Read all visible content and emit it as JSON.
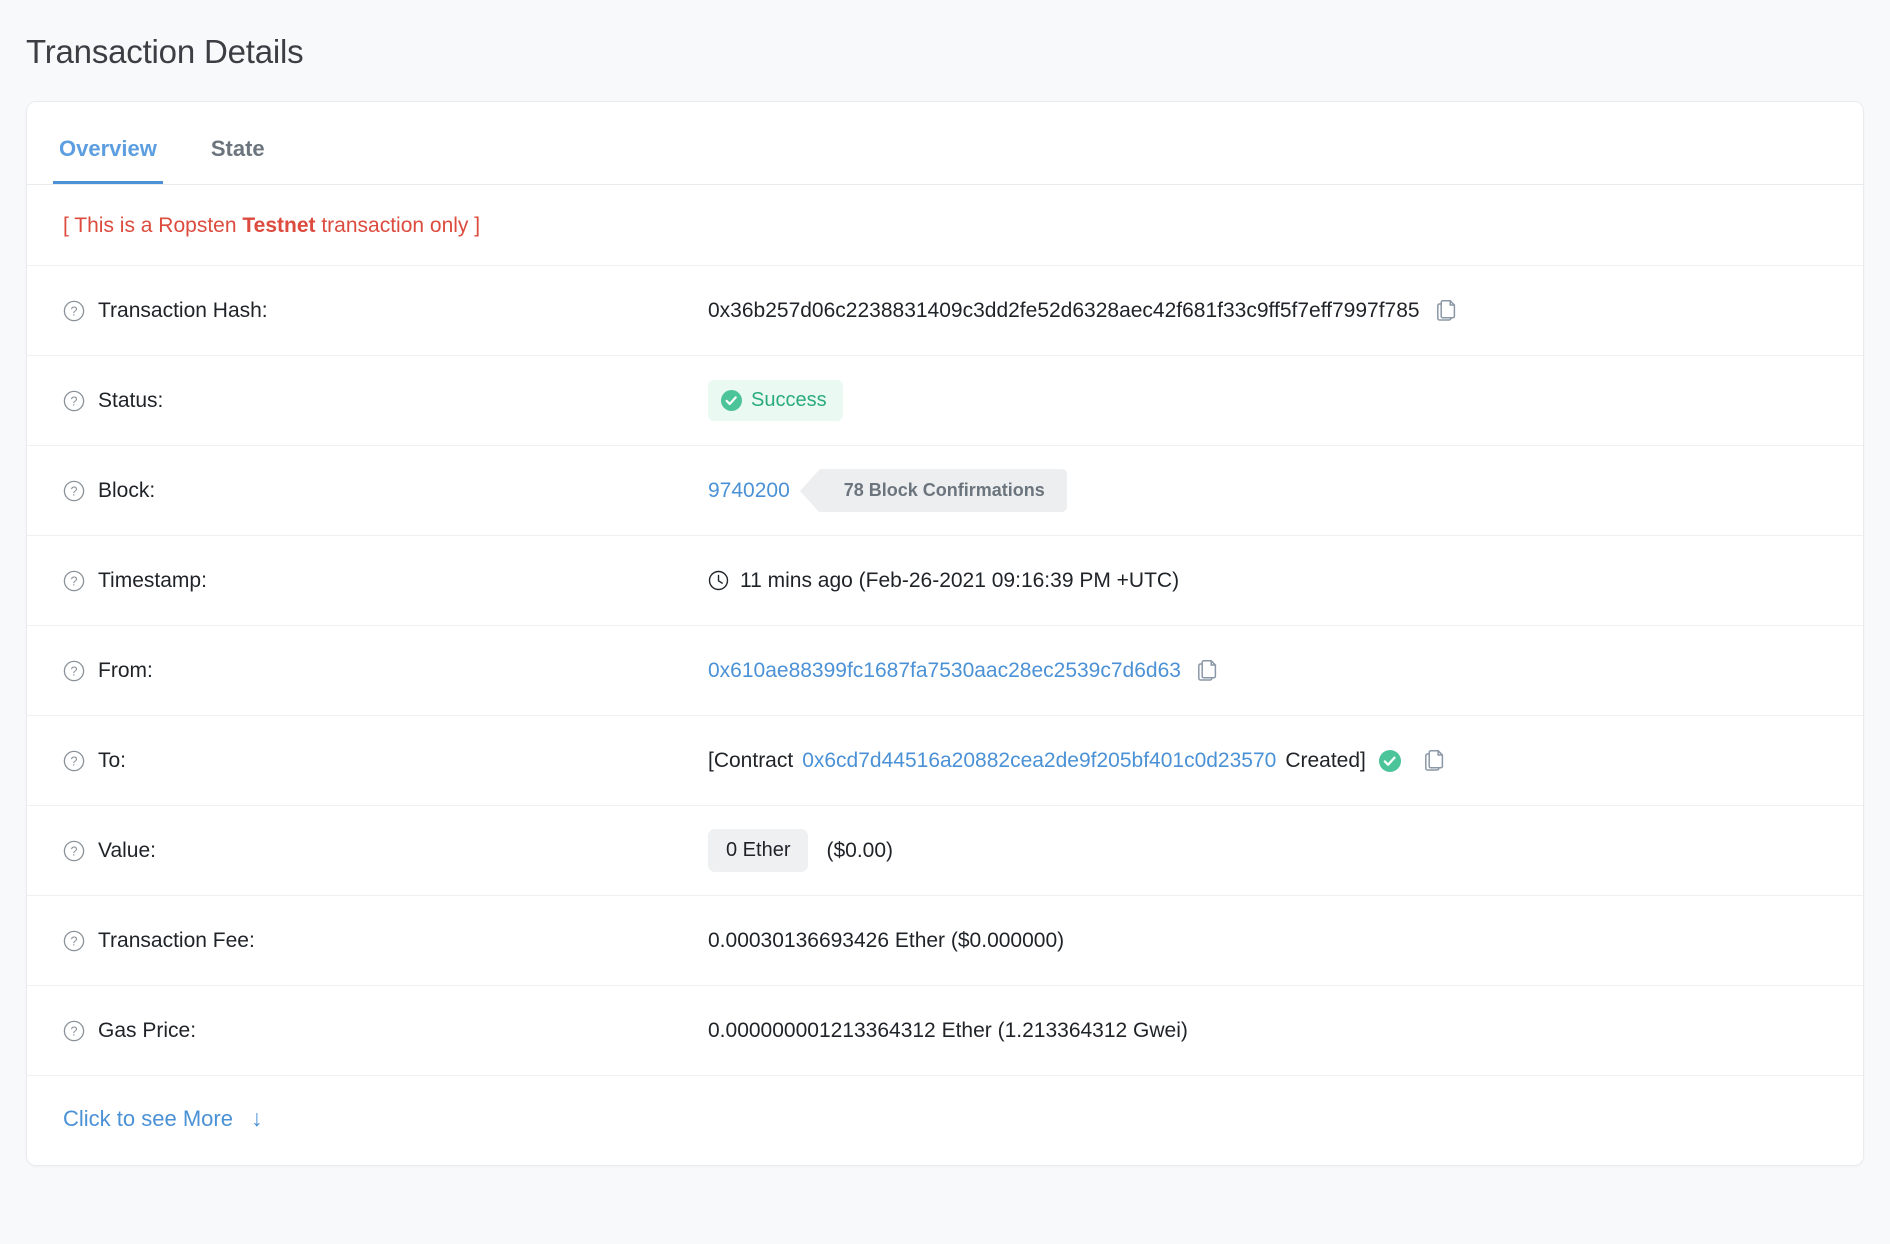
{
  "header": {
    "title": "Transaction Details"
  },
  "tabs": [
    {
      "label": "Overview",
      "active": true
    },
    {
      "label": "State",
      "active": false
    }
  ],
  "notice": {
    "prefix": "[ This is a Ropsten ",
    "emphasis": "Testnet",
    "suffix": " transaction only ]"
  },
  "rows": {
    "tx_hash": {
      "label": "Transaction Hash:",
      "value": "0x36b257d06c2238831409c3dd2fe52d6328aec42f681f33c9ff5f7eff7997f785"
    },
    "status": {
      "label": "Status:",
      "value": "Success"
    },
    "block": {
      "label": "Block:",
      "number": "9740200",
      "confirmations": "78 Block Confirmations"
    },
    "timestamp": {
      "label": "Timestamp:",
      "value": "11 mins ago (Feb-26-2021 09:16:39 PM +UTC)"
    },
    "from": {
      "label": "From:",
      "value": "0x610ae88399fc1687fa7530aac28ec2539c7d6d63"
    },
    "to": {
      "label": "To:",
      "prefix": "[Contract",
      "address": "0x6cd7d44516a20882cea2de9f205bf401c0d23570",
      "suffix": "Created]"
    },
    "value": {
      "label": "Value:",
      "amount": "0 Ether",
      "fiat": "($0.00)"
    },
    "tx_fee": {
      "label": "Transaction Fee:",
      "value": "0.00030136693426 Ether ($0.000000)"
    },
    "gas_price": {
      "label": "Gas Price:",
      "value": "0.000000001213364312 Ether (1.213364312 Gwei)"
    }
  },
  "footer": {
    "more_label": "Click to see More",
    "more_arrow": "↓"
  },
  "colors": {
    "link": "#4b91d6",
    "success": "#2aab7f",
    "warning": "#dc4b3e",
    "muted": "#6c757d"
  }
}
